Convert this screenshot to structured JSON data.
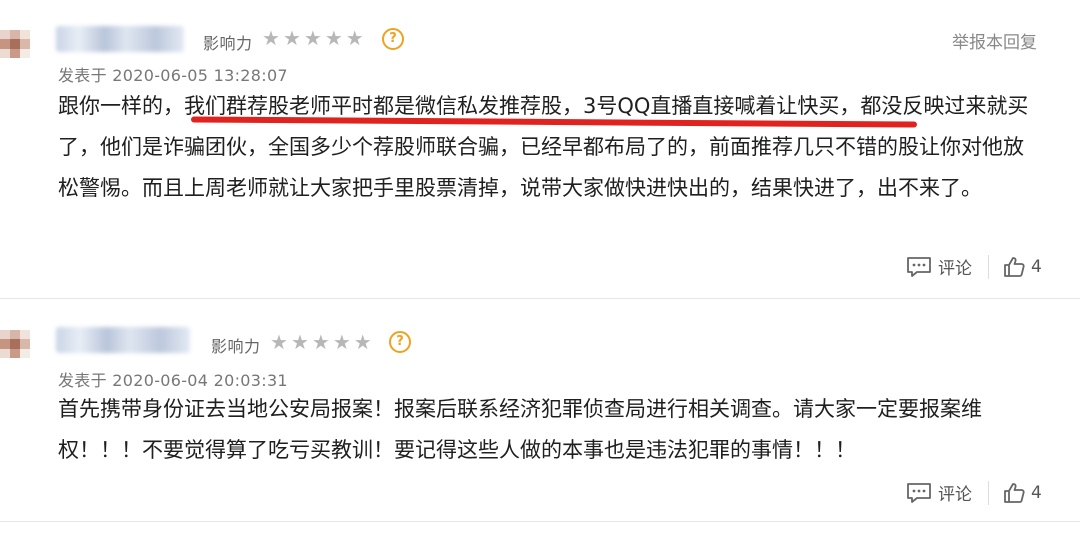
{
  "comments": [
    {
      "influence_label": "影响力",
      "stars": [
        "★",
        "★",
        "★",
        "★",
        "★"
      ],
      "help_icon": "?",
      "report_label": "举报本回复",
      "time": "发表于 2020-06-05 13:28:07",
      "text_before": "跟你一样的，",
      "text_highlight": "我们群荐股老师平时都是微信私发推荐股，3号QQ直播直接喊着让快买，",
      "text_after": "都没反映过来就买了，他们是诈骗团伙，全国多少个荐股师联合骗，已经早都布局了的，前面推荐几只不错的股让你对他放松警惕。而且上周老师就让大家把手里股票清掉，说带大家做快进快出的，结果快进了，出不来了。",
      "comment_label": "评论",
      "like_count": "4"
    },
    {
      "influence_label": "影响力",
      "stars": [
        "★",
        "★",
        "★",
        "★",
        "★"
      ],
      "help_icon": "?",
      "time": "发表于 2020-06-04 20:03:31",
      "text": "首先携带身份证去当地公安局报案！报案后联系经济犯罪侦查局进行相关调查。请大家一定要报案维权！！！不要觉得算了吃亏买教训！要记得这些人做的本事也是违法犯罪的事情！！！",
      "comment_label": "评论",
      "like_count": "4"
    }
  ],
  "colors": {
    "highlight_underline": "#e0231e",
    "help_icon": "#f0a21f",
    "star_inactive": "#b7b7b7"
  },
  "icons": {
    "comment": "comment-bubble-icon",
    "like": "thumbs-up-icon"
  }
}
